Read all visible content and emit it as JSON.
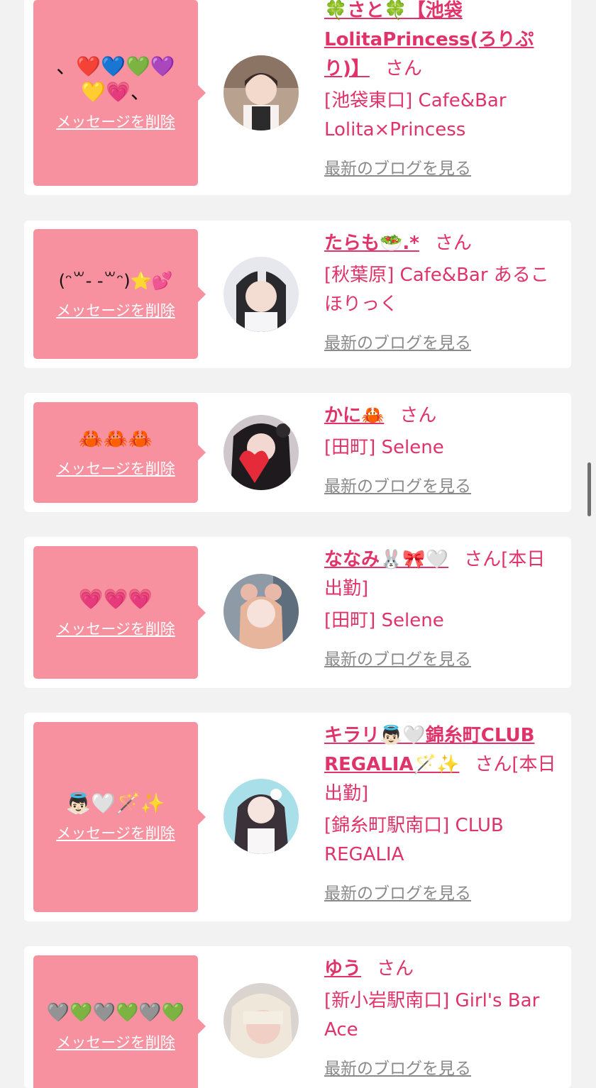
{
  "delete_label": "メッセージを削除",
  "blog_label": "最新のブログを見る",
  "honorific": "さん",
  "colors": {
    "accent": "#e0336a",
    "bubble": "#f7909f",
    "card": "#ffffff",
    "background": "#f2f2f2"
  },
  "entries": [
    {
      "message": "、❤️💙💚💜💛💗、",
      "name": "🍀さと🍀【池袋LolitaPrincess(ろりぷり)】",
      "suffix": "さん",
      "shop": "[池袋東口] Cafe&Bar Lolita×Princess"
    },
    {
      "message": "(ᵔ꒳- -꒳ᵔ)⭐️💕",
      "name": "たらも🥗.*",
      "suffix": "さん",
      "shop": "[秋葉原] Cafe&Bar あるこほりっく"
    },
    {
      "message": "🦀🦀🦀",
      "name": "かに🦀",
      "suffix": "さん",
      "shop": "[田町] Selene"
    },
    {
      "message": "💗💗💗",
      "name": "ななみ🐰🎀🤍",
      "suffix": "さん[本日出勤]",
      "shop": "[田町] Selene"
    },
    {
      "message": "👼🏻🤍🪄✨",
      "name": "キラリ👼🏻🤍錦糸町CLUB REGALIA🪄✨",
      "suffix": "さん[本日出勤]",
      "shop": "[錦糸町駅南口] CLUB REGALIA"
    },
    {
      "message": "🩶💚🩶💚🩶💚",
      "name": "ゆう",
      "suffix": "さん",
      "shop": "[新小岩駅南口] Girl's Bar Ace"
    }
  ]
}
